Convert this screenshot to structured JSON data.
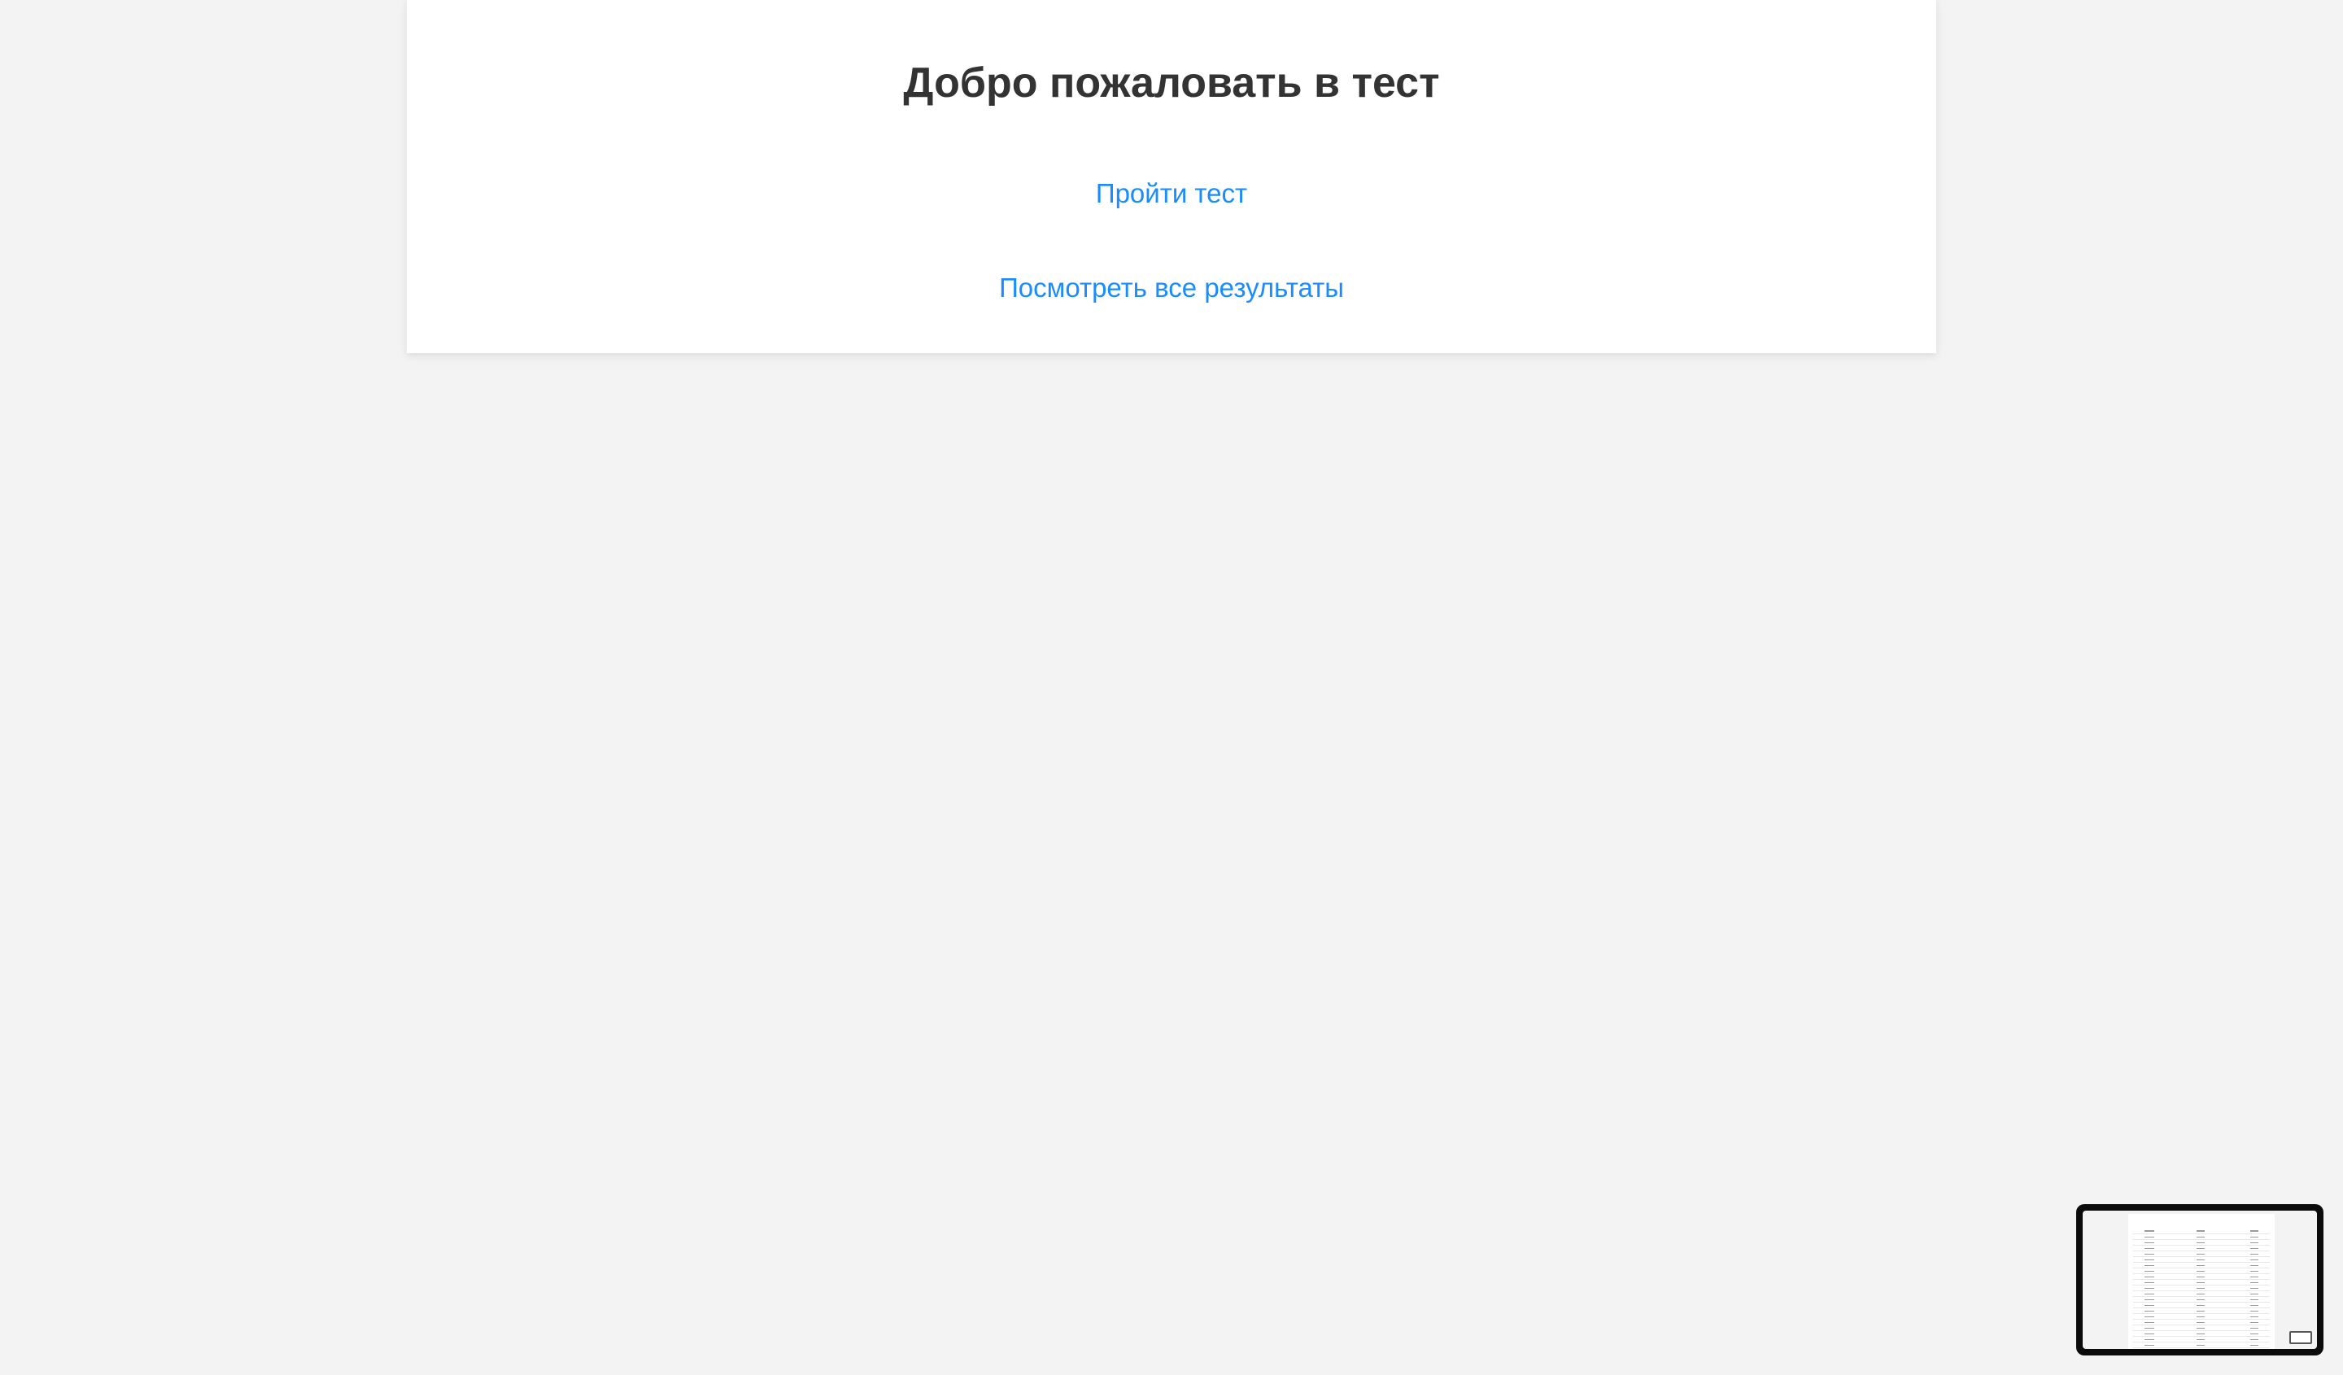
{
  "main": {
    "title": "Добро пожаловать в тест",
    "links": {
      "take_test": "Пройти тест",
      "view_results": "Посмотреть все результаты"
    }
  },
  "colors": {
    "background": "#f3f3f3",
    "card": "#ffffff",
    "title": "#333333",
    "link": "#1a8cff"
  },
  "preview": {
    "icon": "expand-icon"
  }
}
